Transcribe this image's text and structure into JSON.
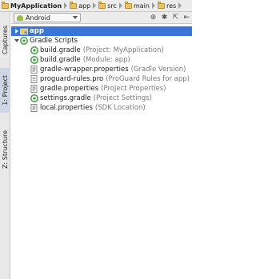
{
  "breadcrumb": [
    {
      "label": "MyApplication",
      "icon": "folder-icon"
    },
    {
      "label": "app",
      "icon": "folder-icon"
    },
    {
      "label": "src",
      "icon": "folder-icon"
    },
    {
      "label": "main",
      "icon": "folder-icon"
    },
    {
      "label": "res",
      "icon": "folder-icon"
    }
  ],
  "side_tabs": [
    {
      "label": "Captures"
    },
    {
      "label": "1: Project",
      "active": true
    },
    {
      "label": "Z: Structure"
    }
  ],
  "toolbar": {
    "view_select": "Android",
    "icons": [
      "sync-icon",
      "settings-icon",
      "pin-icon",
      "hide-icon"
    ]
  },
  "tree": [
    {
      "name": "app",
      "hint": "",
      "icon": "app-module-icon",
      "expanded": false,
      "selected": true
    },
    {
      "name": "Gradle Scripts",
      "hint": "",
      "icon": "gradle-scripts-icon",
      "expanded": true,
      "selected": false
    },
    {
      "name": "build.gradle",
      "hint": "(Project: MyApplication)",
      "icon": "gradle-file-icon"
    },
    {
      "name": "build.gradle",
      "hint": "(Module: app)",
      "icon": "gradle-file-icon"
    },
    {
      "name": "gradle-wrapper.properties",
      "hint": "(Gradle Version)",
      "icon": "properties-file-icon"
    },
    {
      "name": "proguard-rules.pro",
      "hint": "(ProGuard Rules for app)",
      "icon": "text-file-icon"
    },
    {
      "name": "gradle.properties",
      "hint": "(Project Properties)",
      "icon": "properties-file-icon"
    },
    {
      "name": "settings.gradle",
      "hint": "(Project Settings)",
      "icon": "gradle-file-icon"
    },
    {
      "name": "local.properties",
      "hint": "(SDK Location)",
      "icon": "properties-file-icon"
    }
  ],
  "colors": {
    "selection": "#3875d7",
    "hint_text": "#7a7a7a",
    "gradle_green": "#3f9e3f",
    "android_green": "#98c046"
  }
}
